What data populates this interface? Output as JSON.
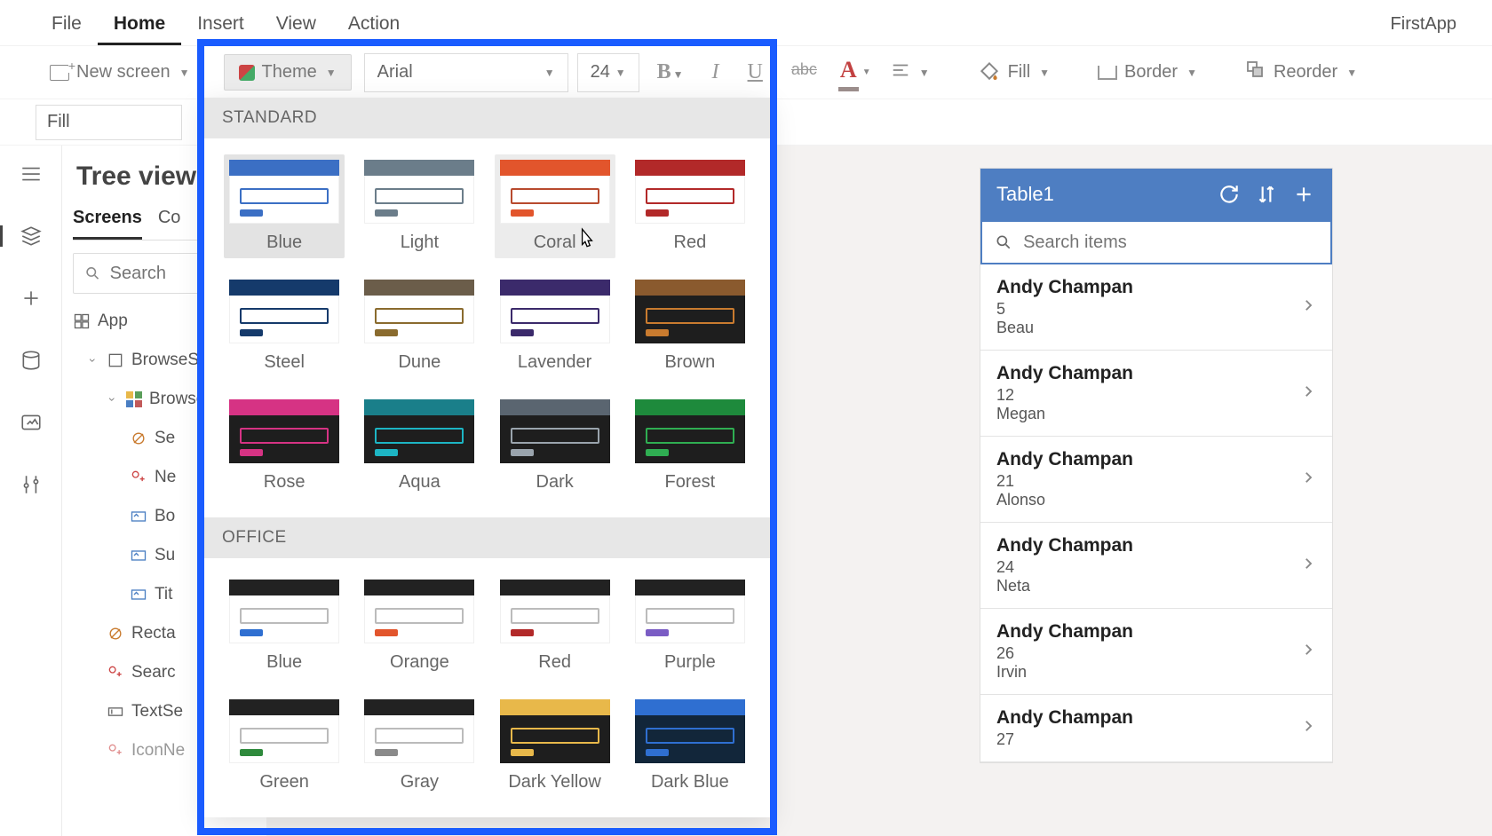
{
  "appName": "FirstApp",
  "menu": {
    "items": [
      "File",
      "Home",
      "Insert",
      "View",
      "Action"
    ],
    "active": "Home"
  },
  "toolbar": {
    "newScreen": "New screen",
    "theme": "Theme",
    "fontName": "Arial",
    "fontSize": "24",
    "fill": "Fill",
    "border": "Border",
    "reorder": "Reorder"
  },
  "formula": {
    "property": "Fill"
  },
  "tree": {
    "title": "Tree view",
    "tabs": [
      "Screens",
      "Co"
    ],
    "activeTab": "Screens",
    "searchPlaceholder": "Search",
    "app": "App",
    "nodes": {
      "browseScreen": "BrowseSc",
      "browseGallery": "Browse",
      "sep": "Se",
      "next": "Ne",
      "body": "Bo",
      "sub": "Su",
      "title": "Tit",
      "rect": "Recta",
      "searchIcon": "Searc",
      "textSearch": "TextSe",
      "iconNew": "IconNe"
    }
  },
  "device": {
    "title": "Table1",
    "searchPlaceholder": "Search items",
    "items": [
      {
        "name": "Andy Champan",
        "line2": "5",
        "line3": "Beau"
      },
      {
        "name": "Andy Champan",
        "line2": "12",
        "line3": "Megan"
      },
      {
        "name": "Andy Champan",
        "line2": "21",
        "line3": "Alonso"
      },
      {
        "name": "Andy Champan",
        "line2": "24",
        "line3": "Neta"
      },
      {
        "name": "Andy Champan",
        "line2": "26",
        "line3": "Irvin"
      },
      {
        "name": "Andy Champan",
        "line2": "27",
        "line3": ""
      }
    ]
  },
  "themes": {
    "standardLabel": "STANDARD",
    "officeLabel": "OFFICE",
    "standard": [
      {
        "name": "Blue",
        "top": "#3b6fc4",
        "body": "#3b6fc4",
        "bar": "#3b6fc4",
        "bg": "light",
        "selected": true
      },
      {
        "name": "Light",
        "top": "#6b7d8a",
        "body": "#6b7d8a",
        "bar": "#6b7d8a",
        "bg": "light"
      },
      {
        "name": "Coral",
        "top": "#e2552c",
        "body": "#b84a2e",
        "bar": "#e2552c",
        "bg": "light",
        "hovered": true
      },
      {
        "name": "Red",
        "top": "#b22929",
        "body": "#b22929",
        "bar": "#b22929",
        "bg": "light"
      },
      {
        "name": "Steel",
        "top": "#153a6b",
        "body": "#153a6b",
        "bar": "#153a6b",
        "bg": "light"
      },
      {
        "name": "Dune",
        "top": "#6b5d4a",
        "body": "#8a6b2e",
        "bar": "#8a6b2e",
        "bg": "light"
      },
      {
        "name": "Lavender",
        "top": "#3b2a6b",
        "body": "#3b2a6b",
        "bar": "#3b2a6b",
        "bg": "light"
      },
      {
        "name": "Brown",
        "top": "#8a5a2e",
        "body": "#c97b2f",
        "bar": "#c97b2f",
        "bg": "dark"
      },
      {
        "name": "Rose",
        "top": "#d63384",
        "body": "#d63384",
        "bar": "#d63384",
        "bg": "dark"
      },
      {
        "name": "Aqua",
        "top": "#1a7f8a",
        "body": "#1db5c4",
        "bar": "#1db5c4",
        "bg": "dark"
      },
      {
        "name": "Dark",
        "top": "#5a6570",
        "body": "#9aa4ad",
        "bar": "#9aa4ad",
        "bg": "dark"
      },
      {
        "name": "Forest",
        "top": "#1e8a3c",
        "body": "#2fae52",
        "bar": "#2fae52",
        "bg": "dark"
      }
    ],
    "office": [
      {
        "name": "Blue",
        "top": "#222",
        "body": "#bbb",
        "bar": "#2f6fd1",
        "bg": "light"
      },
      {
        "name": "Orange",
        "top": "#222",
        "body": "#bbb",
        "bar": "#e2552c",
        "bg": "light"
      },
      {
        "name": "Red",
        "top": "#222",
        "body": "#bbb",
        "bar": "#b22929",
        "bg": "light"
      },
      {
        "name": "Purple",
        "top": "#222",
        "body": "#bbb",
        "bar": "#7a5cc4",
        "bg": "light"
      },
      {
        "name": "Green",
        "top": "#222",
        "body": "#bbb",
        "bar": "#2e8a3c",
        "bg": "light"
      },
      {
        "name": "Gray",
        "top": "#222",
        "body": "#bbb",
        "bar": "#8a8a8a",
        "bg": "light"
      },
      {
        "name": "Dark Yellow",
        "top": "#e8b84a",
        "body": "#e8b84a",
        "bar": "#e8b84a",
        "bg": "dark"
      },
      {
        "name": "Dark Blue",
        "top": "#2f6fd1",
        "body": "#2f6fd1",
        "bar": "#2f6fd1",
        "bg": "navy"
      }
    ]
  }
}
